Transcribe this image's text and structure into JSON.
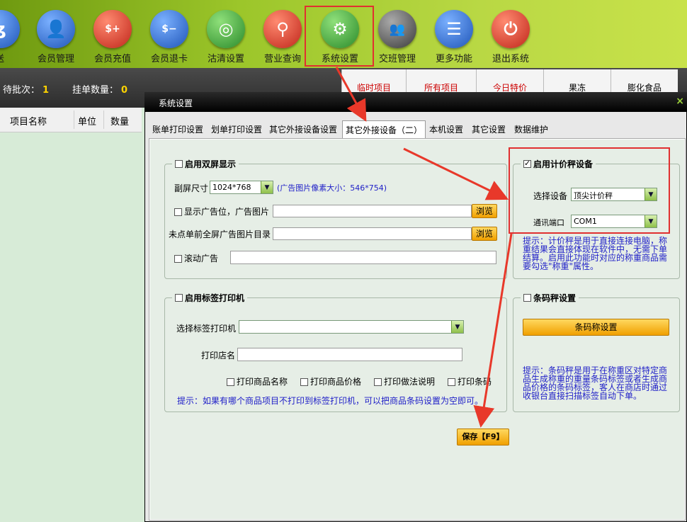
{
  "toolbar": {
    "items": [
      {
        "label": "配送",
        "icon": "delivery-icon",
        "color": "#2f6fd0"
      },
      {
        "label": "会员管理",
        "icon": "member-icon",
        "color": "#2f6fd0"
      },
      {
        "label": "会员充值",
        "icon": "recharge-icon",
        "color": "#d83a2a"
      },
      {
        "label": "会员退卡",
        "icon": "refund-card-icon",
        "color": "#2f6fd0"
      },
      {
        "label": "沽清设置",
        "icon": "plate-icon",
        "color": "#3a9a3a"
      },
      {
        "label": "营业查询",
        "icon": "magnifier-icon",
        "color": "#d83a2a"
      },
      {
        "label": "系统设置",
        "icon": "gear-icon",
        "color": "#3a9a3a"
      },
      {
        "label": "交班管理",
        "icon": "team-icon",
        "color": "#555555"
      },
      {
        "label": "更多功能",
        "icon": "list-icon",
        "color": "#2f6fd0"
      },
      {
        "label": "退出系统",
        "icon": "power-icon",
        "color": "#d83a2a"
      }
    ]
  },
  "status": {
    "pending_label": "待批次：",
    "pending_value": "1",
    "held_label": "挂单数量：",
    "held_value": "0"
  },
  "categories": [
    "临时项目",
    "所有项目",
    "今日特价",
    "果冻",
    "膨化食品"
  ],
  "order_list": {
    "columns": [
      "项目名称",
      "单位",
      "数量"
    ]
  },
  "dialog": {
    "title": "系统设置",
    "close": "×",
    "tabs": [
      "账单打印设置",
      "划单打印设置",
      "其它外接设备设置",
      "其它外接设备（二）",
      "本机设置",
      "其它设置",
      "数据维护"
    ],
    "dual_screen": {
      "title": "启用双屏显示",
      "enabled": false,
      "size_label": "副屏尺寸",
      "size_value": "1024*768",
      "ad_size_hint": "(广告图片像素大小：546*754)",
      "show_ad_label": "显示广告位，广告图片",
      "show_ad_value": "",
      "browse1": "浏览",
      "fullscreen_label": "未点单前全屏广告图片目录",
      "fullscreen_value": "",
      "browse2": "浏览",
      "scroll_label": "滚动广告",
      "scroll_value": ""
    },
    "scale": {
      "title": "启用计价秤设备",
      "enabled": true,
      "device_label": "选择设备",
      "device_value": "顶尖计价秤",
      "port_label": "通讯端口",
      "port_value": "COM1",
      "hint_lines": [
        "提示：计价秤是用于直接连接电脑，称",
        "重结果会直接体现在软件中，无需下单",
        "结算。启用此功能时对应的称重商品需",
        "要勾选\"称重\"属性。"
      ]
    },
    "label_printer": {
      "title": "启用标签打印机",
      "enabled": false,
      "printer_label": "选择标签打印机",
      "printer_value": "",
      "shop_label": "打印店名",
      "shop_value": "",
      "opt_name": "打印商品名称",
      "opt_price": "打印商品价格",
      "opt_method": "打印做法说明",
      "opt_barcode": "打印条码",
      "hint": "提示：如果有哪个商品项目不打印到标签打印机，可以把商品条码设置为空即可。"
    },
    "barcode_scale": {
      "title": "条码秤设置",
      "enabled": false,
      "button": "条码称设置",
      "hint_lines": [
        "提示：条码秤是用于在称重区对特定商",
        "品生成称重的重量条码标签或者生成商",
        "品价格的条码标签，客人在商店时通过",
        "收银台直接扫描标签自动下单。"
      ]
    },
    "save": "保存【F9】"
  }
}
